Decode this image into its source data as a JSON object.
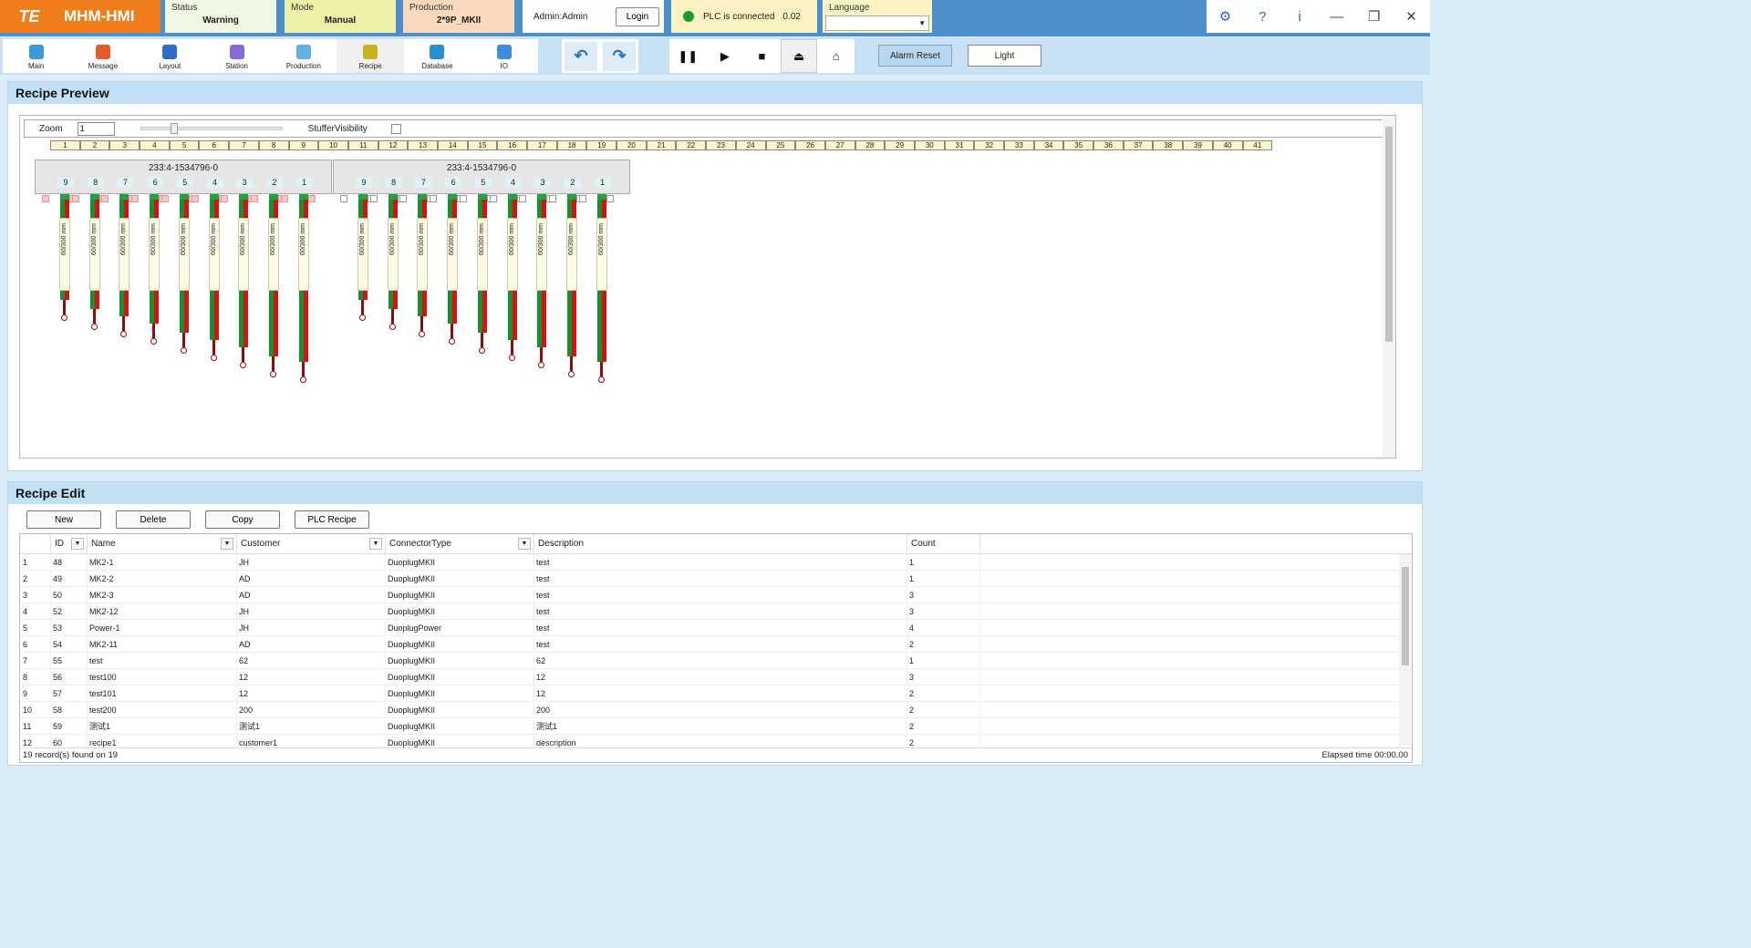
{
  "app": {
    "logo": "TE",
    "title": "MHM-HMI"
  },
  "status": {
    "caption": "Status",
    "value": "Warning"
  },
  "mode": {
    "caption": "Mode",
    "value": "Manual"
  },
  "production": {
    "caption": "Production",
    "value": "2*9P_MKII"
  },
  "user": {
    "label": "Admin:Admin",
    "login_label": "Login"
  },
  "plc": {
    "status_text": "PLC is connected",
    "value": "0.02",
    "status_color": "#1a9c2e"
  },
  "language": {
    "caption": "Language",
    "selected": ""
  },
  "window_controls": {
    "icons": [
      "gear-icon",
      "help-icon",
      "info-icon",
      "minimize-icon",
      "restore-icon",
      "close-icon"
    ],
    "glyphs": [
      "⚙",
      "?",
      "i",
      "—",
      "❐",
      "✕"
    ]
  },
  "nav": {
    "items": [
      {
        "label": "Main",
        "icon": "home-icon",
        "color": "#3a9bd8"
      },
      {
        "label": "Message",
        "icon": "mail-icon",
        "color": "#e85a2a"
      },
      {
        "label": "Layout",
        "icon": "layout-icon",
        "color": "#2d6fc8"
      },
      {
        "label": "Station",
        "icon": "station-icon",
        "color": "#8a6ad8"
      },
      {
        "label": "Production",
        "icon": "production-icon",
        "color": "#62b0e4"
      },
      {
        "label": "Recipe",
        "icon": "recipe-icon",
        "color": "#c9b21a"
      },
      {
        "label": "Database",
        "icon": "database-icon",
        "color": "#2a8fd0"
      },
      {
        "label": "IO",
        "icon": "io-icon",
        "color": "#3a8fd8"
      }
    ],
    "active": "Recipe"
  },
  "history": {
    "undo_icon": "undo-icon",
    "redo_icon": "redo-icon",
    "undo_glyph": "↶",
    "redo_glyph": "↷"
  },
  "controls": {
    "pause_glyph": "❚❚",
    "play_glyph": "▶",
    "stop_glyph": "■",
    "eject_glyph": "⏏",
    "home_glyph": "⌂"
  },
  "actions": {
    "alarm_reset": "Alarm Reset",
    "light": "Light"
  },
  "preview": {
    "title": "Recipe Preview",
    "zoom_label": "Zoom",
    "zoom_value": "1",
    "stuffer_label": "StufferVisibility",
    "positions": [
      "1",
      "2",
      "3",
      "4",
      "5",
      "6",
      "7",
      "8",
      "9",
      "10",
      "11",
      "12",
      "13",
      "14",
      "15",
      "16",
      "17",
      "18",
      "19",
      "20",
      "21",
      "22",
      "23",
      "24",
      "25",
      "26",
      "27",
      "28",
      "29",
      "30",
      "31",
      "32",
      "33",
      "34",
      "35",
      "36",
      "37",
      "38",
      "39",
      "40",
      "41"
    ],
    "connectors": [
      {
        "title": "233:4-1534796-0",
        "slots": [
          "9",
          "8",
          "7",
          "6",
          "5",
          "4",
          "3",
          "2",
          "1"
        ]
      },
      {
        "title": "233:4-1534796-0",
        "slots": [
          "9",
          "8",
          "7",
          "6",
          "5",
          "4",
          "3",
          "2",
          "1"
        ]
      }
    ],
    "wire_label": "60/300 mm"
  },
  "edit": {
    "title": "Recipe Edit",
    "buttons": {
      "new": "New",
      "delete": "Delete",
      "copy": "Copy",
      "plc_recipe": "PLC Recipe"
    },
    "columns": [
      "ID",
      "Name",
      "Customer",
      "ConnectorType",
      "Description",
      "Count"
    ],
    "rows": [
      [
        "1",
        "48",
        "MK2-1",
        "JH",
        "DuoplugMKII",
        "test",
        "1"
      ],
      [
        "2",
        "49",
        "MK2-2",
        "AD",
        "DuoplugMKII",
        "test",
        "1"
      ],
      [
        "3",
        "50",
        "MK2-3",
        "AD",
        "DuoplugMKII",
        "test",
        "3"
      ],
      [
        "4",
        "52",
        "MK2-12",
        "JH",
        "DuoplugMKII",
        "test",
        "3"
      ],
      [
        "5",
        "53",
        "Power-1",
        "JH",
        "DuoplugPower",
        "test",
        "4"
      ],
      [
        "6",
        "54",
        "MK2-11",
        "AD",
        "DuoplugMKII",
        "test",
        "2"
      ],
      [
        "7",
        "55",
        "test",
        "62",
        "DuoplugMKII",
        "62",
        "1"
      ],
      [
        "8",
        "56",
        "test100",
        "12",
        "DuoplugMKII",
        "12",
        "3"
      ],
      [
        "9",
        "57",
        "test101",
        "12",
        "DuoplugMKII",
        "12",
        "2"
      ],
      [
        "10",
        "58",
        "test200",
        "200",
        "DuoplugMKII",
        "200",
        "2"
      ],
      [
        "11",
        "59",
        "测试1",
        "测试1",
        "DuoplugMKII",
        "测试1",
        "2"
      ],
      [
        "12",
        "60",
        "recipe1",
        "customer1",
        "DuoplugMKII",
        "description",
        "2"
      ]
    ],
    "footer_left": "19 record(s) found on 19",
    "footer_right": "Elapsed time 00:00.00"
  }
}
